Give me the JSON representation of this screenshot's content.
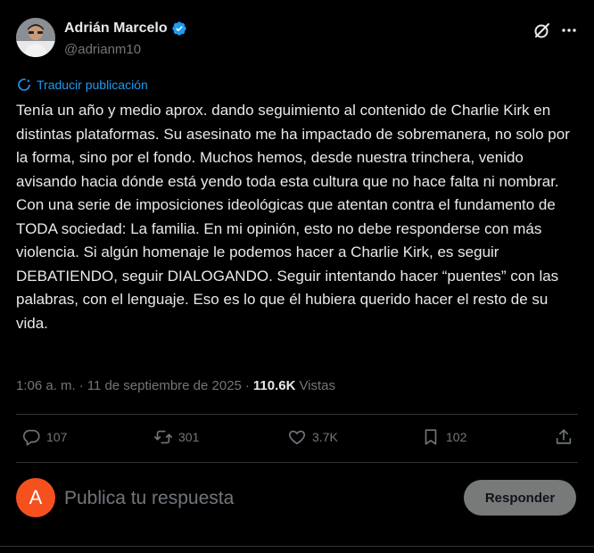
{
  "author": {
    "display_name": "Adrián Marcelo",
    "handle": "@adrianm10",
    "verified": true,
    "avatar_icon": "profile-photo"
  },
  "translate": {
    "label": "Traducir publicación",
    "icon": "translate-icon"
  },
  "tweet": {
    "text": "Tenía un año y medio aprox. dando seguimiento al contenido de Charlie Kirk en distintas plataformas. Su asesinato me ha impactado de sobremanera, no solo por la forma, sino por el fondo. Muchos hemos, desde nuestra trinchera, venido avisando hacia dónde está yendo toda esta cultura que no hace falta ni nombrar. Con una serie de imposiciones ideológicas que atentan contra el fundamento de TODA sociedad: La familia. En mi opinión, esto no debe responderse con más violencia. Si algún homenaje le podemos hacer a Charlie Kirk, es seguir DEBATIENDO, seguir DIALOGANDO. Seguir intentando hacer “puentes” con las palabras, con el lenguaje. Eso es lo que él hubiera querido hacer el resto de su vida."
  },
  "meta": {
    "time": "1:06 a. m.",
    "separator": "·",
    "date": "11 de septiembre de 2025",
    "views_count": "110.6K",
    "views_label": "Vistas"
  },
  "actions": {
    "replies": "107",
    "reposts": "301",
    "likes": "3.7K",
    "bookmarks": "102"
  },
  "composer": {
    "avatar_letter": "A",
    "placeholder": "Publica tu respuesta",
    "button_label": "Responder"
  },
  "colors": {
    "background": "#000000",
    "text": "#e7e9ea",
    "secondary": "#71767b",
    "link": "#1d9bf0",
    "verified": "#1d9bf0",
    "reply_avatar": "#f4511e",
    "reply_button": "#787a7a"
  }
}
